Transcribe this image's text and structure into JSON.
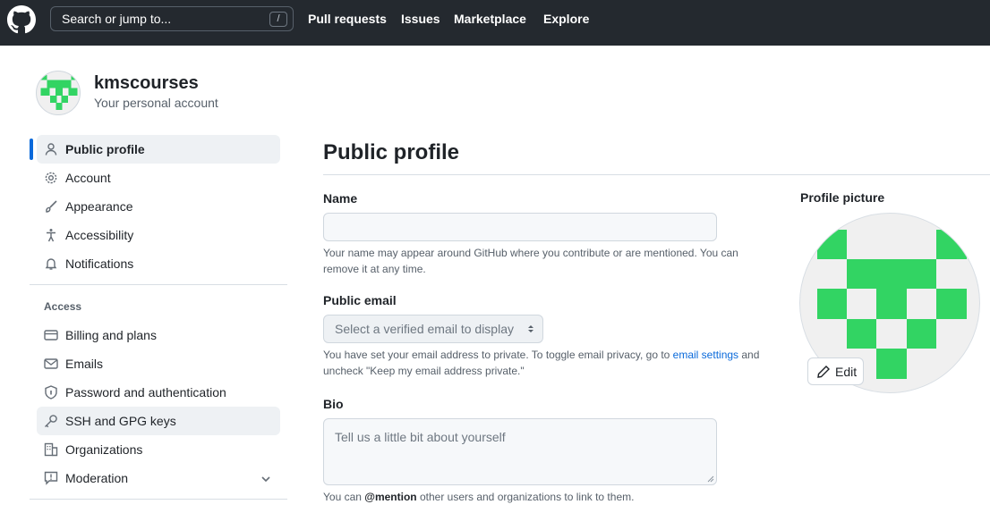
{
  "header": {
    "search_placeholder": "Search or jump to...",
    "search_shortcut": "/",
    "nav": [
      "Pull requests",
      "Issues",
      "Marketplace",
      "Explore"
    ]
  },
  "account": {
    "username": "kmscourses",
    "subtitle": "Your personal account"
  },
  "sidebar": {
    "items": [
      {
        "label": "Public profile",
        "icon": "person-icon",
        "selected": true
      },
      {
        "label": "Account",
        "icon": "gear-icon"
      },
      {
        "label": "Appearance",
        "icon": "paintbrush-icon"
      },
      {
        "label": "Accessibility",
        "icon": "accessibility-icon"
      },
      {
        "label": "Notifications",
        "icon": "bell-icon"
      }
    ],
    "access_heading": "Access",
    "access_items": [
      {
        "label": "Billing and plans",
        "icon": "credit-card-icon"
      },
      {
        "label": "Emails",
        "icon": "mail-icon"
      },
      {
        "label": "Password and authentication",
        "icon": "shield-lock-icon"
      },
      {
        "label": "SSH and GPG keys",
        "icon": "key-icon",
        "hovered": true
      },
      {
        "label": "Organizations",
        "icon": "organization-icon"
      },
      {
        "label": "Moderation",
        "icon": "report-icon",
        "expandable": true
      }
    ]
  },
  "main": {
    "title": "Public profile",
    "name_label": "Name",
    "name_value": "",
    "name_note": "Your name may appear around GitHub where you contribute or are mentioned. You can remove it at any time.",
    "email_label": "Public email",
    "email_select": "Select a verified email to display",
    "email_note_before": "You have set your email address to private. To toggle email privacy, go to ",
    "email_note_link": "email settings",
    "email_note_after": " and uncheck \"Keep my email address private.\"",
    "bio_label": "Bio",
    "bio_placeholder": "Tell us a little bit about yourself",
    "bio_note_before": "You can ",
    "bio_note_mention": "@mention",
    "bio_note_after": " other users and organizations to link to them."
  },
  "profile_picture": {
    "label": "Profile picture",
    "edit_label": "Edit"
  },
  "colors": {
    "header_bg": "#24292f",
    "accent": "#0969da",
    "avatar_green": "#32d463"
  }
}
